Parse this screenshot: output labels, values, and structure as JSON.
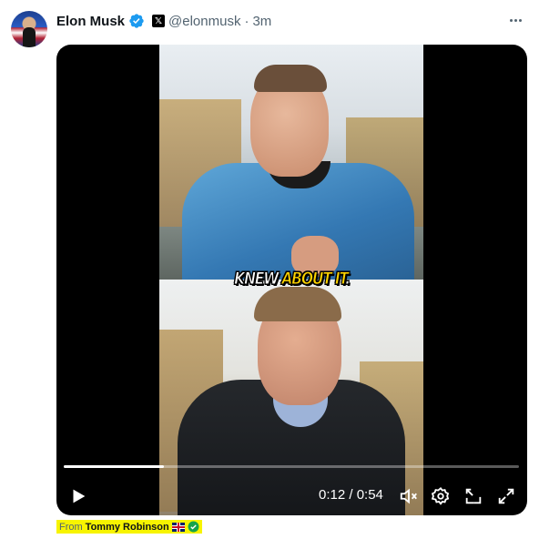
{
  "post": {
    "author_name": "Elon Musk",
    "handle": "@elonmusk",
    "separator": "·",
    "time": "3m",
    "verified_color": "#1d9bf0"
  },
  "video": {
    "caption_part1": "KNEW ",
    "caption_part2": "ABOUT IT",
    "caption_part3": ".",
    "caption_colors": {
      "normal": "#ffffff",
      "highlight": "#ffd400"
    },
    "current_time": "0:12",
    "duration": "0:54",
    "timecode": "0:12 / 0:54",
    "progress_fraction": 0.22,
    "controls": {
      "play_icon": "play-icon",
      "mute_icon": "muted-speaker-icon",
      "settings_icon": "gear-icon",
      "pip_icon": "picture-in-picture-icon",
      "fullscreen_icon": "fullscreen-icon"
    }
  },
  "source": {
    "label": "From",
    "name": "Tommy Robinson",
    "highlight_color": "#f7f400"
  }
}
